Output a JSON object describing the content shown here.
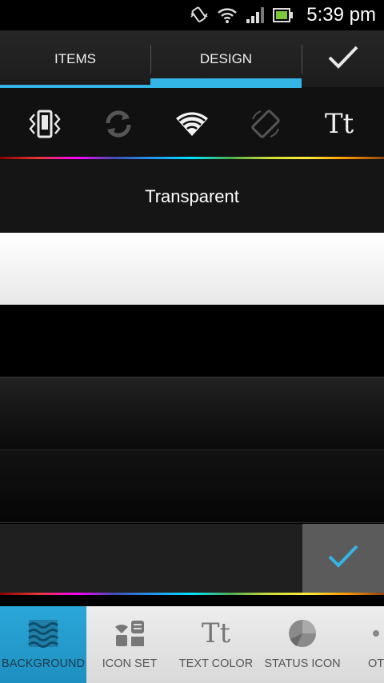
{
  "status_bar": {
    "time": "5:39 pm",
    "icons": [
      "vibrate-icon",
      "wifi-icon",
      "signal-icon",
      "battery-icon"
    ]
  },
  "tabs": [
    {
      "label": "ITEMS",
      "selected": false
    },
    {
      "label": "DESIGN",
      "selected": true
    }
  ],
  "confirm_icon": "checkmark-icon",
  "quick_settings_icons": [
    "vibrate-icon",
    "sync-icon",
    "wifi-icon",
    "auto-rotate-icon",
    "text-size-icon"
  ],
  "background_options": [
    {
      "label": "Transparent"
    },
    {
      "label": ""
    },
    {
      "label": ""
    },
    {
      "label": ""
    },
    {
      "label": ""
    },
    {
      "label": "",
      "selected": true
    }
  ],
  "categories": [
    {
      "label": "BACKGROUND",
      "icon": "background-waves-icon",
      "active": true
    },
    {
      "label": "ICON SET",
      "icon": "icon-set-icon",
      "active": false
    },
    {
      "label": "TEXT COLOR",
      "icon": "text-color-icon",
      "active": false
    },
    {
      "label": "STATUS ICON",
      "icon": "status-icon-icon",
      "active": false
    },
    {
      "label": "OT",
      "icon": "dot-icon",
      "active": false
    }
  ],
  "colors": {
    "accent": "#33b5e5",
    "active_category": "#2ba7d8",
    "check": "#33b5e5"
  }
}
